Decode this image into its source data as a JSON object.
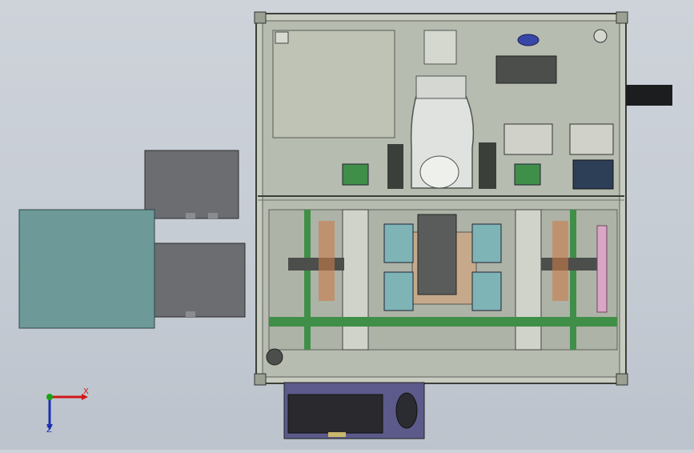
{
  "viewport": {
    "background_top": "#ced3da",
    "background_bottom": "#bcc3cc"
  },
  "triad": {
    "x_label": "X",
    "z_label": "Z",
    "x_color": "#d01818",
    "y_color": "#16a316",
    "z_color": "#1c2fb0"
  },
  "colors": {
    "teal_block": "#6d9a98",
    "grey_block": "#6b6d70",
    "frame": "#b9bfb0",
    "rail": "#3f8f48",
    "panel": "#a7a9a2",
    "base_plate": "#5b5a8a",
    "accent_pink": "#d9a6c6",
    "accent_orange": "#c97c4a"
  }
}
